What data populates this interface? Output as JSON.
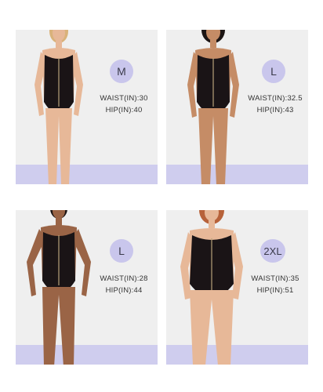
{
  "colors": {
    "card_bg": "#efefef",
    "band": "#cfcdee",
    "badge": "#c9c6ec",
    "skin_light": "#e7b898",
    "skin_medium": "#c58c66",
    "skin_dark": "#9a6446",
    "garment": "#1a1416"
  },
  "panels": [
    {
      "size": "M",
      "waist": "WAIST(IN):30",
      "hip": "HIP(IN):40",
      "hair": "blonde"
    },
    {
      "size": "L",
      "waist": "WAIST(IN):32.5",
      "hip": "HIP(IN):43",
      "hair": "dark"
    },
    {
      "size": "L",
      "waist": "WAIST(IN):28",
      "hip": "HIP(IN):44",
      "hair": "dark"
    },
    {
      "size": "2XL",
      "waist": "WAIST(IN):35",
      "hip": "HIP(IN):51",
      "hair": "red"
    }
  ]
}
